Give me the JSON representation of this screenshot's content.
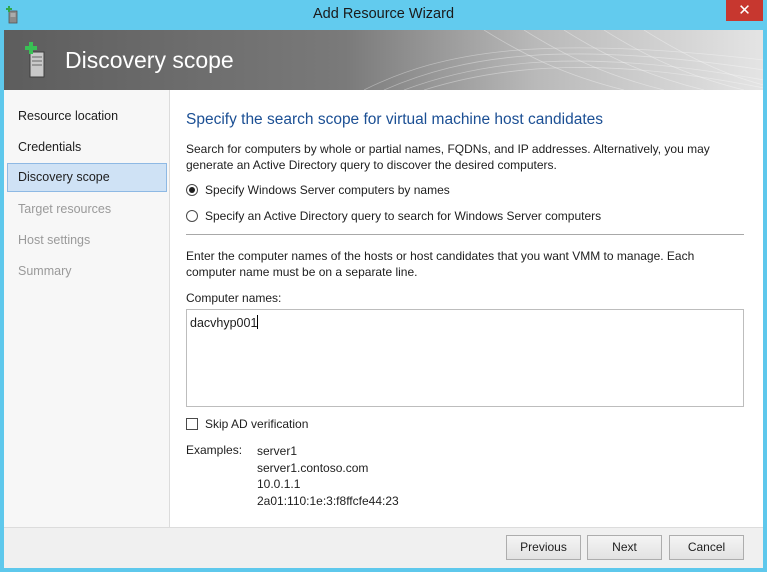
{
  "window": {
    "title": "Add Resource Wizard",
    "close_glyph": "✕",
    "icon": "server-add-icon"
  },
  "banner": {
    "title": "Discovery scope",
    "icon": "server-add-icon"
  },
  "sidebar": {
    "items": [
      {
        "label": "Resource location",
        "state": "enabled"
      },
      {
        "label": "Credentials",
        "state": "enabled"
      },
      {
        "label": "Discovery scope",
        "state": "active"
      },
      {
        "label": "Target resources",
        "state": "disabled"
      },
      {
        "label": "Host settings",
        "state": "disabled"
      },
      {
        "label": "Summary",
        "state": "disabled"
      }
    ]
  },
  "main": {
    "heading": "Specify the search scope for virtual machine host candidates",
    "intro_line1": "Search for computers by whole or partial names, FQDNs, and IP addresses. Alternatively, you may",
    "intro_line2": "generate an Active Directory query to discover the desired computers.",
    "radio_names": {
      "label": "Specify Windows Server computers by names",
      "checked": true
    },
    "radio_ad": {
      "label": "Specify an Active Directory query to search for Windows Server computers",
      "checked": false
    },
    "instructions_line1": "Enter the computer names of the hosts or host candidates that you want VMM to manage. Each",
    "instructions_line2": "computer name must be on a separate line.",
    "computer_names_label": "Computer names:",
    "computer_names_value": "dacvhyp001",
    "skip_ad_label": "Skip AD verification",
    "skip_ad_checked": false,
    "examples_label": "Examples:",
    "examples": [
      "server1",
      "server1.contoso.com",
      "10.0.1.1",
      "2a01:110:1e:3:f8ffcfe44:23"
    ]
  },
  "footer": {
    "previous_label": "Previous",
    "next_label": "Next",
    "cancel_label": "Cancel"
  },
  "colors": {
    "frame": "#5ec8ec",
    "heading": "#1b4f94",
    "close": "#c7372f",
    "selected_nav": "#cfe2f5"
  }
}
